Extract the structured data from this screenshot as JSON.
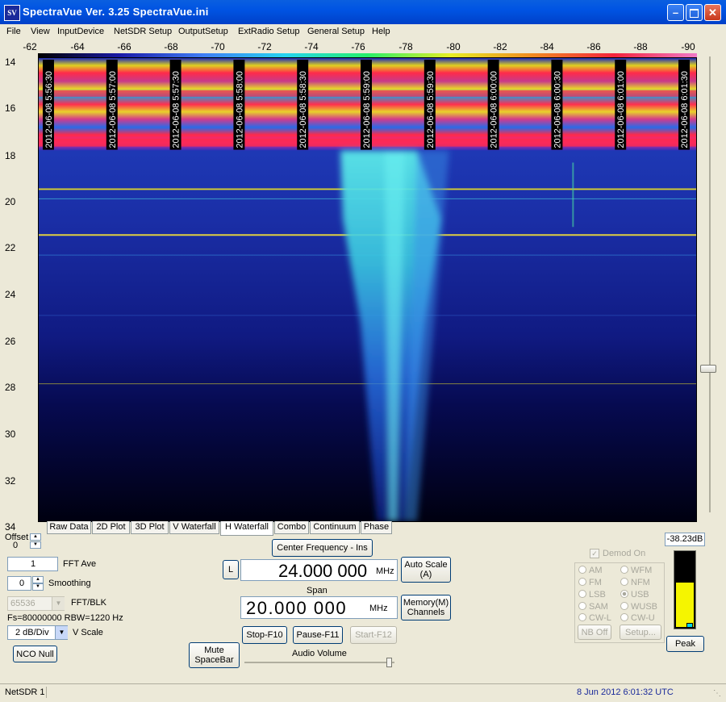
{
  "window": {
    "title": "SpectraVue Ver. 3.25  SpectraVue.ini",
    "icon_text": "SV",
    "min_icon": "minimize-icon",
    "max_icon": "maximize-icon",
    "close_icon": "close-icon"
  },
  "menu": [
    "File",
    "View",
    "InputDevice",
    "NetSDR Setup",
    "OutputSetup",
    "ExtRadio Setup",
    "General Setup",
    "Help"
  ],
  "top_axis_labels": [
    "-62",
    "-64",
    "-66",
    "-68",
    "-70",
    "-72",
    "-74",
    "-76",
    "-78",
    "-80",
    "-82",
    "-84",
    "-86",
    "-88",
    "-90"
  ],
  "left_axis_labels": [
    "14",
    "16",
    "18",
    "20",
    "22",
    "24",
    "26",
    "28",
    "30",
    "32",
    "34"
  ],
  "timestamps": [
    "2012-06-08 5:56:30",
    "2012-06-08 5:57:00",
    "2012-06-08 5:57:30",
    "2012-06-08 5:58:00",
    "2012-06-08 5:58:30",
    "2012-06-08 5:59:00",
    "2012-06-08 5:59:30",
    "2012-06-08 6:00:00",
    "2012-06-08 6:00:30",
    "2012-06-08 6:01:00",
    "2012-06-08 6:01:30"
  ],
  "tabs": [
    "Raw Data",
    "2D Plot",
    "3D Plot",
    "V Waterfall",
    "H Waterfall",
    "Combo",
    "Continuum",
    "Phase"
  ],
  "active_tab": "H Waterfall",
  "controls": {
    "offset_label": "Offset",
    "offset_value": "0",
    "fft_ave_value": "1",
    "fft_ave_label": "FFT Ave",
    "smoothing_value": "0",
    "smoothing_label": "Smoothing",
    "fft_blk_value": "65536",
    "fft_blk_label": "FFT/BLK",
    "fs_info": "Fs=80000000 RBW=1220 Hz",
    "vscale_value": "2 dB/Div",
    "vscale_label": "V Scale",
    "nco_null": "NCO Null",
    "center_freq_button": "Center Frequency - Ins",
    "l_button": "L",
    "center_freq_value": "24.000 000",
    "freq_unit": "MHz",
    "span_label": "Span",
    "span_value": "20.000 000",
    "span_unit": "MHz",
    "auto_scale_1": "Auto Scale",
    "auto_scale_2": "(A)",
    "memory_1": "Memory(M)",
    "memory_2": "Channels",
    "stop": "Stop-F10",
    "pause": "Pause-F11",
    "start": "Start-F12",
    "mute_1": "Mute",
    "mute_2": "SpaceBar",
    "audio_volume": "Audio Volume",
    "audio_volume_level": 0.98
  },
  "demod": {
    "label": "Demod On",
    "checked": true,
    "modes_left": [
      "AM",
      "FM",
      "LSB",
      "SAM",
      "CW-L"
    ],
    "modes_right": [
      "WFM",
      "NFM",
      "USB",
      "WUSB",
      "CW-U"
    ],
    "selected": "USB",
    "nb_off": "NB Off",
    "setup": "Setup..."
  },
  "signal": {
    "level": "-38.23dB",
    "peak_button": "Peak",
    "meter_fill": 0.6
  },
  "status": {
    "device": "NetSDR 1",
    "datetime": "8 Jun 2012  6:01:32 UTC"
  },
  "colors": {
    "titlebar": "#0054e3",
    "plot_bg": "#000000",
    "meter": "#f5f500",
    "status_date": "#1a2a9a"
  }
}
